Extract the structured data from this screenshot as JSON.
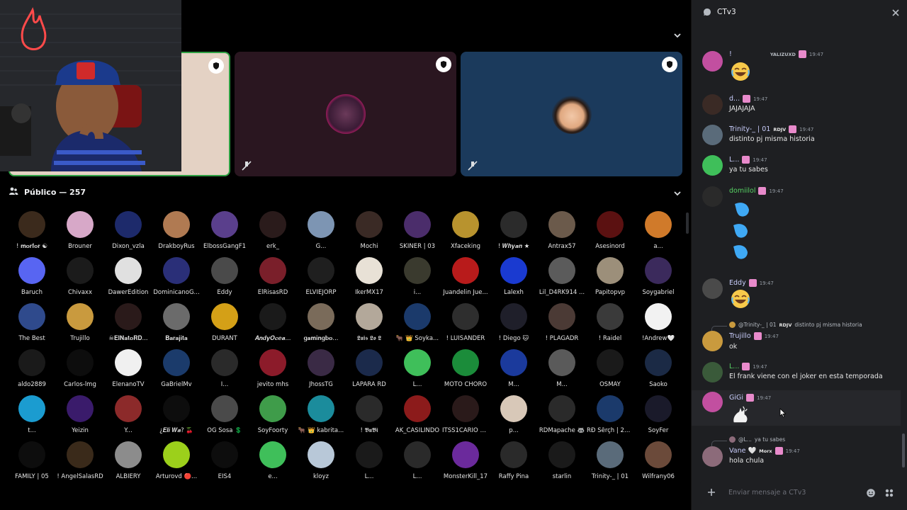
{
  "stage": {
    "public_label": "Público — 257",
    "members": [
      {
        "name": "! 𝐦𝐨𝐫𝐟𝐨𝐫 ☯",
        "color": "#3b2a1c"
      },
      {
        "name": "Brouner",
        "color": "#d7a8c8"
      },
      {
        "name": "Dixon_vzla",
        "color": "#1d2a6b"
      },
      {
        "name": "DrakboyRus",
        "color": "#b07a52"
      },
      {
        "name": "ElbossGangF1",
        "color": "#5a3f8c"
      },
      {
        "name": "erk_",
        "color": "#2a1b1b"
      },
      {
        "name": "G...",
        "color": "#7d95b3"
      },
      {
        "name": "Mochi",
        "color": "#3a2a25"
      },
      {
        "name": "SKINER | 03",
        "color": "#4b2d6b"
      },
      {
        "name": "Xfaceking",
        "color": "#b8932e"
      },
      {
        "name": "! 𝑾𝒉𝒚𝒂𝒏 ★",
        "color": "#2b2b2b"
      },
      {
        "name": "Antrax57",
        "color": "#6b5a4b"
      },
      {
        "name": "Asesinord",
        "color": "#5b1111"
      },
      {
        "name": "a...",
        "color": "#d07a2a"
      },
      {
        "name": "Baruch",
        "color": "#5865f2"
      },
      {
        "name": "Chivaxx",
        "color": "#1b1b1b"
      },
      {
        "name": "DawerEdition",
        "color": "#e0e0e0"
      },
      {
        "name": "DominicanoG...",
        "color": "#2a2f78"
      },
      {
        "name": "Eddy",
        "color": "#4a4a4a"
      },
      {
        "name": "ElRisasRD",
        "color": "#7a1f2a"
      },
      {
        "name": "ELVIEJORP",
        "color": "#1f1f1f"
      },
      {
        "name": "IkerMX17",
        "color": "#e8e1d6"
      },
      {
        "name": "i...",
        "color": "#3a3a2e"
      },
      {
        "name": "Juandelin Jue...",
        "color": "#b81b1b"
      },
      {
        "name": "Lalexh",
        "color": "#1a3ad0"
      },
      {
        "name": "Lil_D4RK914 ...",
        "color": "#5b5b5b"
      },
      {
        "name": "Papitopvp",
        "color": "#9c8f7a"
      },
      {
        "name": "Soygabriel",
        "color": "#3b2a5c"
      },
      {
        "name": "The Best",
        "color": "#2f4a8c"
      },
      {
        "name": "Trujillo",
        "color": "#c99a3e"
      },
      {
        "name": "☠𝐄𝐥𝐍𝐚𝐭𝐨𝐑𝐃...",
        "color": "#2a1a1a"
      },
      {
        "name": "𝐁𝐚𝐫𝐚𝐣𝐢𝐭𝐚",
        "color": "#6b6b6b"
      },
      {
        "name": "DURANT",
        "color": "#d4a017"
      },
      {
        "name": "𝑨𝒏𝒅𝒚𝑶𝒄𝒆𝒂...",
        "color": "#1a1a1a"
      },
      {
        "name": "𝐠𝐚𝐦𝐢𝐧𝐠𝐛𝐨...",
        "color": "#7a6b5a"
      },
      {
        "name": "𝕷𝖚𝖎𝖘 𝕷𝖔 𝕷",
        "color": "#b3a89a"
      },
      {
        "name": "🐂 👑 Soyka...",
        "color": "#1b3a6b"
      },
      {
        "name": "! LUISANDER",
        "color": "#2e2e2e"
      },
      {
        "name": "! Diego 🐱",
        "color": "#1f1f2a"
      },
      {
        "name": "! PLAGADR",
        "color": "#4b3a35"
      },
      {
        "name": "! Raidel",
        "color": "#3a3a3a"
      },
      {
        "name": "!Andrew🤍",
        "color": "#f2f2f2"
      },
      {
        "name": "aldo2889",
        "color": "#1a1a1a"
      },
      {
        "name": "Carlos-lmg",
        "color": "#0d0d0d"
      },
      {
        "name": "ElenanoTV",
        "color": "#f0f0f0"
      },
      {
        "name": "GaBrielMv",
        "color": "#1b3b6b"
      },
      {
        "name": "I...",
        "color": "#2a2a2a"
      },
      {
        "name": "jevito mhs",
        "color": "#8c1b2a"
      },
      {
        "name": "JhossTG",
        "color": "#3a2a45"
      },
      {
        "name": "LAPARA RD",
        "color": "#1b2a4b"
      },
      {
        "name": "L...",
        "color": "#3fbf5a"
      },
      {
        "name": "MOTO CHORO",
        "color": "#1b8c3a"
      },
      {
        "name": "M...",
        "color": "#1b3a9c"
      },
      {
        "name": "M...",
        "color": "#5a5a5a"
      },
      {
        "name": "OSMAY",
        "color": "#1a1a1a"
      },
      {
        "name": "Saoko",
        "color": "#1b2a45"
      },
      {
        "name": "t...",
        "color": "#1b9cd0"
      },
      {
        "name": "Yeizin",
        "color": "#3a1b6b"
      },
      {
        "name": "Y...",
        "color": "#8c2a2a"
      },
      {
        "name": "¿𝑬𝒍𝒊 𝑾𝒂? 🍒",
        "color": "#0d0d0d"
      },
      {
        "name": "OG Sosa 💲",
        "color": "#4a4a4a"
      },
      {
        "name": "SoyFoorty",
        "color": "#3f9c4a"
      },
      {
        "name": "🐂 👑 kabrita...",
        "color": "#1b8c9c"
      },
      {
        "name": "! 𝕭𝖚𝕭𝖎",
        "color": "#2a2a2a"
      },
      {
        "name": "AK_CASILINDO",
        "color": "#8c1b1b"
      },
      {
        "name": "ITSS1CARIO O...",
        "color": "#2a1a1a"
      },
      {
        "name": "p...",
        "color": "#d8c8b8"
      },
      {
        "name": "RDMapache 🦝",
        "color": "#2a2a2a"
      },
      {
        "name": "RÐ Šêrçh | 20 ...",
        "color": "#1b3a6b"
      },
      {
        "name": "SoyFer",
        "color": "#1a1a2a"
      },
      {
        "name": "FAMILY | 05",
        "color": "#0d0d0d"
      },
      {
        "name": "! AngelSalasRD",
        "color": "#3a2a1a"
      },
      {
        "name": "ALBIERY",
        "color": "#8c8c8c"
      },
      {
        "name": "Arturovd 🔴...",
        "color": "#9cd01b"
      },
      {
        "name": "EIS4",
        "color": "#0d0d0d"
      },
      {
        "name": "e...",
        "color": "#3fbf5a"
      },
      {
        "name": "kloyz",
        "color": "#b8c8d8"
      },
      {
        "name": "L...",
        "color": "#1a1a1a"
      },
      {
        "name": "L...",
        "color": "#2a2a2a"
      },
      {
        "name": "MonsterKill_17",
        "color": "#6b2a9c"
      },
      {
        "name": "Raffy Pina",
        "color": "#2a2a2a"
      },
      {
        "name": "starlin",
        "color": "#1a1a1a"
      },
      {
        "name": "Trinity-_ | 01",
        "color": "#5a6b7a"
      },
      {
        "name": "Wilfrany06",
        "color": "#6b4a3a"
      }
    ]
  },
  "chat": {
    "title": "CTv3",
    "input_placeholder": "Enviar mensaje a CTv3",
    "messages": [
      {
        "id": "m1",
        "name": "!",
        "time": "19:47",
        "text": "",
        "emoji": "laugh",
        "name_color": "#c9cdfb",
        "avatar": "#c24fa0",
        "extra": "YALIZUXD"
      },
      {
        "id": "m2",
        "name": "d...",
        "time": "19:47",
        "text": "JAJAJAJA",
        "name_color": "#c9cdfb",
        "avatar": "#3a2a25"
      },
      {
        "id": "m3",
        "name": "Trinity-_ | 01",
        "time": "19:47",
        "text": "distinto pj misma historia",
        "name_color": "#c9cdfb",
        "avatar": "#5a6b7a",
        "role": "RDJV"
      },
      {
        "id": "m4",
        "name": "L...",
        "time": "19:47",
        "text": "ya tu sabes",
        "name_color": "#c9cdfb",
        "avatar": "#3fbf5a"
      },
      {
        "id": "m5",
        "name": "domiilol",
        "time": "19:47",
        "text": "",
        "name_color": "#57d364",
        "avatar": "#2a2a2a"
      },
      {
        "id": "m6",
        "name": "Eddy",
        "time": "19:47",
        "text": "",
        "name_color": "#c9cdfb",
        "avatar": "#4a4a4a"
      },
      {
        "id": "m7",
        "name": "Trujillo",
        "time": "19:47",
        "text": "ok",
        "name_color": "#c9cdfb",
        "avatar": "#c99a3e",
        "reply_name": "@Trinity-_ | 01",
        "reply_role": "RDJV",
        "reply_text": "distinto pj misma historia"
      },
      {
        "id": "m8",
        "name": "L...",
        "time": "19:47",
        "text": "El frank viene con el joker en esta temporada",
        "name_color": "#57d364",
        "avatar": "#3a5a3a"
      },
      {
        "id": "m9",
        "name": "GiGi",
        "time": "19:47",
        "text": "",
        "name_color": "#c9cdfb",
        "avatar": "#c24fa0"
      },
      {
        "id": "m10",
        "name": "Vane 🤍",
        "time": "19:47",
        "text": "hola chula",
        "name_color": "#c9cdfb",
        "avatar": "#8c6b7a",
        "role": "Morx",
        "reply_name": "@L...",
        "reply_text": "ya tu sabes"
      }
    ]
  },
  "colors": {
    "accent_green": "#2ea043",
    "panel_bg": "#1e1f22",
    "stage_bg": "#000000"
  }
}
